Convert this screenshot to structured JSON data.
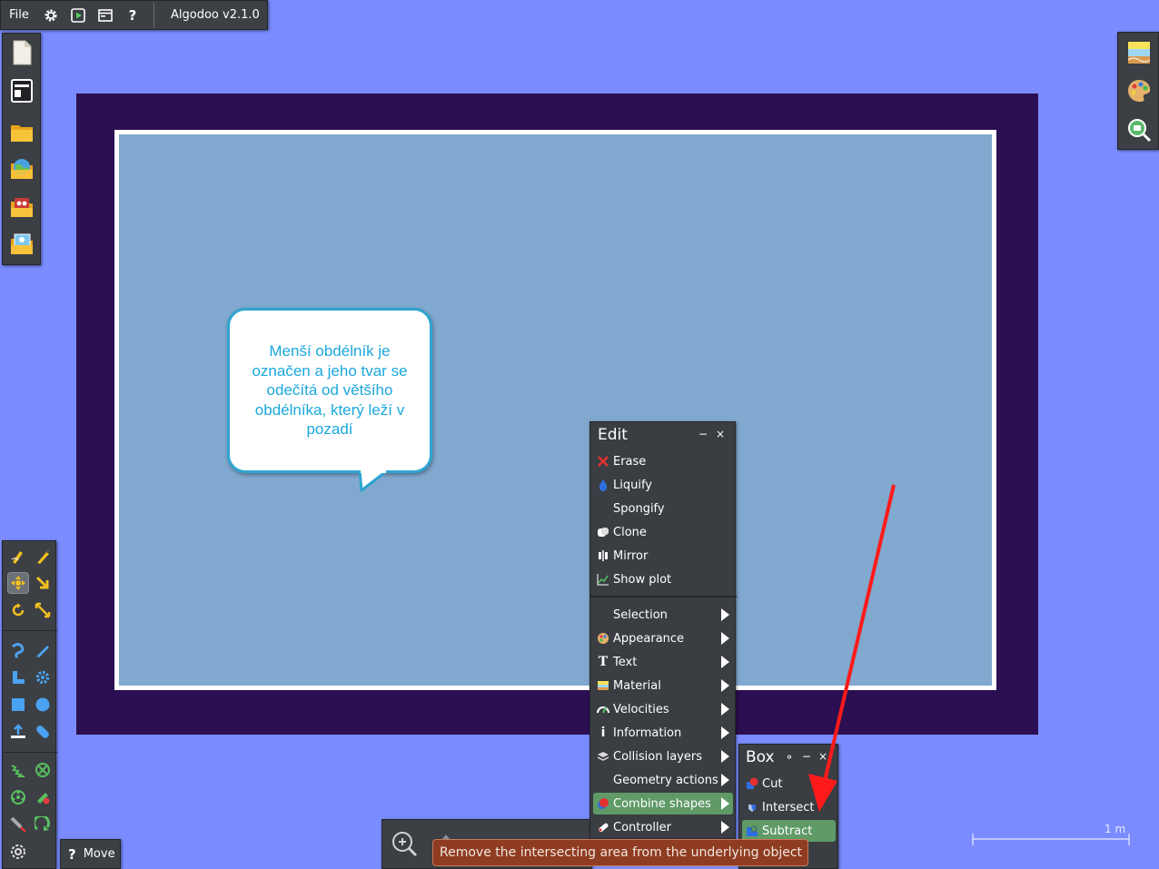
{
  "app": {
    "name": "Algodoo v2.1.0",
    "file_menu": "File",
    "icons": [
      "gear-icon",
      "play-icon",
      "window-icon",
      "help-icon"
    ]
  },
  "file_toolbar": {
    "icons": [
      "new-scene-icon",
      "template-icon",
      "open-folder-icon",
      "online-scenes-icon",
      "open-phun-icon",
      "open-samples-icon"
    ]
  },
  "right_toolbar": {
    "icons": [
      "background-icon",
      "palette-icon",
      "zoom-find-icon"
    ]
  },
  "bubble": {
    "text": "Menší obdélník je označen a jeho tvar se odečítá od většího obdélníka, který leží v pozadí"
  },
  "tools": {
    "icons": [
      "sketch-tool-icon",
      "brush-tool-icon",
      "move-tool-icon",
      "drag-tool-icon",
      "rotate-tool-icon",
      "scale-tool-icon",
      "rope-tool-icon",
      "knife-tool-icon",
      "plane-tool-icon",
      "gear-tool-icon",
      "box-tool-icon",
      "circle-tool-icon",
      "fixate-tool-icon",
      "hinge-tool-icon",
      "spring-tool-icon",
      "axle-tool-icon",
      "wheel-tool-icon",
      "tracer-tool-icon",
      "laser-tool-icon",
      "thruster-tool-icon",
      "chain-tool-icon"
    ],
    "active_label": "Move",
    "help_glyph": "?"
  },
  "edit_menu": {
    "title": "Edit",
    "minimize": "−",
    "close": "×",
    "actions": [
      {
        "label": "Erase",
        "icon": "erase-icon"
      },
      {
        "label": "Liquify",
        "icon": "liquify-icon"
      },
      {
        "label": "Spongify",
        "icon": ""
      },
      {
        "label": "Clone",
        "icon": "clone-icon"
      },
      {
        "label": "Mirror",
        "icon": "mirror-icon"
      },
      {
        "label": "Show plot",
        "icon": "plot-icon"
      }
    ],
    "submenus": [
      {
        "label": "Selection",
        "icon": ""
      },
      {
        "label": "Appearance",
        "icon": "appearance-icon"
      },
      {
        "label": "Text",
        "icon": "text-icon"
      },
      {
        "label": "Material",
        "icon": "material-icon"
      },
      {
        "label": "Velocities",
        "icon": "velocities-icon"
      },
      {
        "label": "Information",
        "icon": "information-icon"
      },
      {
        "label": "Collision layers",
        "icon": "layers-icon"
      },
      {
        "label": "Geometry actions",
        "icon": ""
      },
      {
        "label": "Combine shapes",
        "icon": "combine-icon",
        "highlighted": true
      },
      {
        "label": "Controller",
        "icon": "controller-icon"
      }
    ]
  },
  "box_menu": {
    "title": "Box",
    "pin": "⚬",
    "minimize": "−",
    "close": "×",
    "items": [
      {
        "label": "Cut",
        "icon": "cut-icon"
      },
      {
        "label": "Intersect",
        "icon": "intersect-icon"
      },
      {
        "label": "Subtract",
        "icon": "subtract-icon",
        "highlighted": true
      }
    ]
  },
  "tooltip": {
    "text": "Remove the intersecting area from the underlying object"
  },
  "scale": {
    "label": "1 m"
  },
  "colors": {
    "background": "#7a8cff",
    "frame": "#2b0f52",
    "scene": "#81a8cf",
    "panel": "#3c3f44",
    "highlight": "#5f9a67",
    "tooltip": "#8f3c22",
    "bubble_text": "#1aa8dc",
    "annotation_arrow": "#ff1a1a"
  }
}
